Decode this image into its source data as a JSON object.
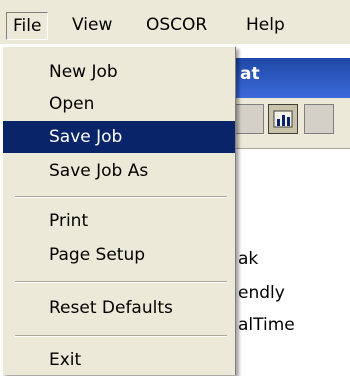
{
  "menubar": {
    "items": [
      {
        "label": "File"
      },
      {
        "label": "View"
      },
      {
        "label": "OSCOR"
      },
      {
        "label": "Help"
      }
    ]
  },
  "background": {
    "title_fragment": "at",
    "lines": [
      "ak",
      "endly",
      "alTime"
    ]
  },
  "file_menu": {
    "items": [
      {
        "label": "New Job"
      },
      {
        "label": "Open"
      },
      {
        "label": "Save Job"
      },
      {
        "label": "Save Job As"
      },
      {
        "label": "Print"
      },
      {
        "label": "Page Setup"
      },
      {
        "label": "Reset Defaults"
      },
      {
        "label": "Exit"
      }
    ],
    "selected": "Save Job"
  },
  "colors": {
    "selection": "#0a246a",
    "menu_bg": "#ece9d8",
    "titlebar": "#1f47a6"
  }
}
